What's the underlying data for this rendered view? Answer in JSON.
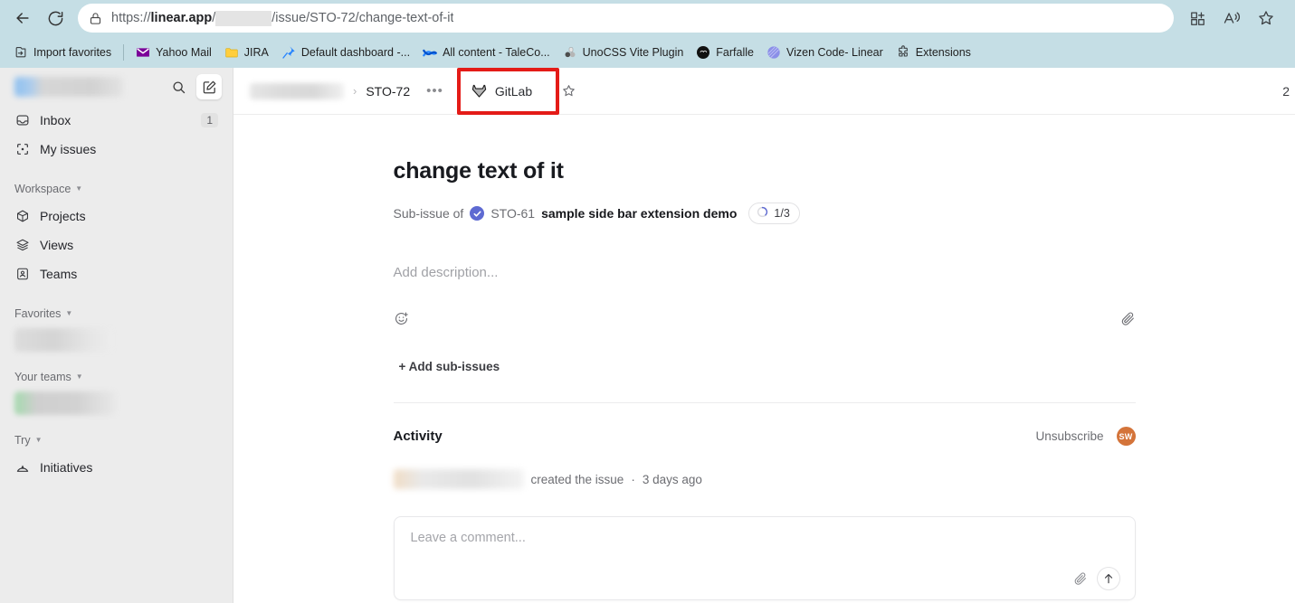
{
  "browser": {
    "back_label": "Back",
    "reload_label": "Reload",
    "url_prefix": "https://",
    "url_domain": "linear.app",
    "url_suffix": "/issue/STO-72/change-text-of-it",
    "lock_icon": "lock-icon",
    "toolbar_icons": [
      "split-screen-icon",
      "read-aloud-icon",
      "favorites-star-icon"
    ],
    "bookmarks": [
      {
        "label": "Import favorites",
        "icon": "import-favorites-icon"
      },
      {
        "label": "Yahoo Mail",
        "icon": "yahoo-mail-icon"
      },
      {
        "label": "JIRA",
        "icon": "folder-icon"
      },
      {
        "label": "Default dashboard -...",
        "icon": "jira-pin-icon"
      },
      {
        "label": "All content - TaleCo...",
        "icon": "confluence-icon"
      },
      {
        "label": "UnoCSS Vite Plugin",
        "icon": "unocss-icon"
      },
      {
        "label": "Farfalle",
        "icon": "farfalle-icon"
      },
      {
        "label": "Vizen Code- Linear",
        "icon": "vizen-icon"
      },
      {
        "label": "Extensions",
        "icon": "extensions-puzzle-icon"
      }
    ]
  },
  "sidebar": {
    "workspace_name": "",
    "search_icon": "search-icon",
    "compose_icon": "compose-icon",
    "items": [
      {
        "label": "Inbox",
        "icon": "inbox-icon",
        "badge": "1"
      },
      {
        "label": "My issues",
        "icon": "my-issues-icon",
        "badge": ""
      }
    ],
    "sections": [
      {
        "label": "Workspace",
        "items": [
          {
            "label": "Projects",
            "icon": "projects-cube-icon"
          },
          {
            "label": "Views",
            "icon": "views-layers-icon"
          },
          {
            "label": "Teams",
            "icon": "teams-icon"
          }
        ]
      },
      {
        "label": "Favorites",
        "items": []
      },
      {
        "label": "Your teams",
        "items": []
      },
      {
        "label": "Try",
        "items": [
          {
            "label": "Initiatives",
            "icon": "initiatives-icon"
          }
        ]
      }
    ]
  },
  "topbar": {
    "breadcrumb_separator": "›",
    "issue_id": "STO-72",
    "more_dots": "•••",
    "gitlab_tab_label": "GitLab",
    "gitlab_icon": "gitlab-fox-icon",
    "star_icon": "star-outline-icon",
    "right_counter": "2",
    "highlight_color": "#e41b17"
  },
  "issue": {
    "title": "change text of it",
    "sub_issue_label": "Sub-issue of",
    "parent_status_icon": "done-check-icon",
    "parent_id": "STO-61",
    "parent_name": "sample side bar extension demo",
    "progress_text": "1/3",
    "progress_icon": "progress-circle-icon",
    "description_placeholder": "Add description...",
    "emoji_icon": "add-reaction-icon",
    "attach_icon": "paperclip-icon",
    "add_sub_issues_label": "+ Add sub-issues"
  },
  "activity": {
    "title": "Activity",
    "unsubscribe_label": "Unsubscribe",
    "avatar_initials": "SW",
    "avatar_color": "#d4743a",
    "entry_text": "created the issue",
    "entry_separator": "·",
    "entry_time": "3 days ago"
  },
  "comment": {
    "placeholder": "Leave a comment...",
    "attach_icon": "paperclip-icon",
    "send_icon": "arrow-up-icon"
  }
}
